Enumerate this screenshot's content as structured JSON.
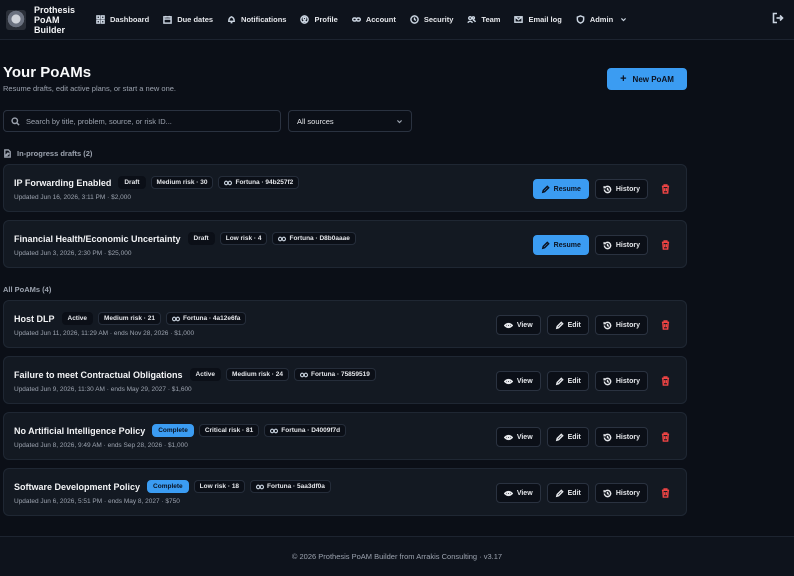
{
  "brand": {
    "name": "Prothesis PoAM Builder"
  },
  "nav": [
    {
      "label": "Dashboard",
      "icon": "dashboard-icon"
    },
    {
      "label": "Due dates",
      "icon": "calendar-icon"
    },
    {
      "label": "Notifications",
      "icon": "bell-icon"
    },
    {
      "label": "Profile",
      "icon": "user-circle-icon"
    },
    {
      "label": "Account",
      "icon": "link-icon"
    },
    {
      "label": "Security",
      "icon": "clock-icon"
    },
    {
      "label": "Team",
      "icon": "users-icon"
    },
    {
      "label": "Email log",
      "icon": "mail-icon"
    },
    {
      "label": "Admin",
      "icon": "shield-icon"
    }
  ],
  "header": {
    "title": "Your PoAMs",
    "subtitle": "Resume drafts, edit active plans, or start a new one.",
    "new_label": "New PoAM"
  },
  "search": {
    "placeholder": "Search by title, problem, source, or risk ID..."
  },
  "filter": {
    "value": "All sources"
  },
  "drafts": {
    "label": "In-progress drafts (2)",
    "items": [
      {
        "title": "IP Forwarding Enabled",
        "status": "Draft",
        "risk": "Medium risk · 30",
        "source": "Fortuna · 94b257f2",
        "meta": "Updated Jun 16, 2026, 3:11 PM · $2,000"
      },
      {
        "title": "Financial Health/Economic Uncertainty",
        "status": "Draft",
        "risk": "Low risk · 4",
        "source": "Fortuna · D8b0aaae",
        "meta": "Updated Jun 3, 2026, 2:30 PM · $25,000"
      }
    ],
    "resume_label": "Resume",
    "history_label": "History"
  },
  "all": {
    "label": "All PoAMs (4)",
    "items": [
      {
        "title": "Host DLP",
        "status": "Active",
        "risk": "Medium risk · 21",
        "source": "Fortuna · 4a12e6fa",
        "meta": "Updated Jun 11, 2026, 11:29 AM · ends Nov 28, 2026 · $1,000"
      },
      {
        "title": "Failure to meet Contractual Obligations",
        "status": "Active",
        "risk": "Medium risk · 24",
        "source": "Fortuna · 75859519",
        "meta": "Updated Jun 9, 2026, 11:30 AM · ends May 29, 2027 · $1,600"
      },
      {
        "title": "No Artificial Intelligence Policy",
        "status": "Complete",
        "risk": "Critical risk · 81",
        "source": "Fortuna · D4009f7d",
        "meta": "Updated Jun 8, 2026, 9:49 AM · ends Sep 28, 2026 · $1,000"
      },
      {
        "title": "Software Development Policy",
        "status": "Complete",
        "risk": "Low risk · 18",
        "source": "Fortuna · 5aa3df0a",
        "meta": "Updated Jun 6, 2026, 5:51 PM · ends May 8, 2027 · $750"
      }
    ],
    "view_label": "View",
    "edit_label": "Edit",
    "history_label": "History"
  },
  "footer": {
    "text": "© 2026 Prothesis PoAM Builder from Arrakis Consulting · v3.17"
  },
  "colors": {
    "accent": "#3b9cf2",
    "danger": "#ef4444",
    "background": "#0b0f17"
  }
}
